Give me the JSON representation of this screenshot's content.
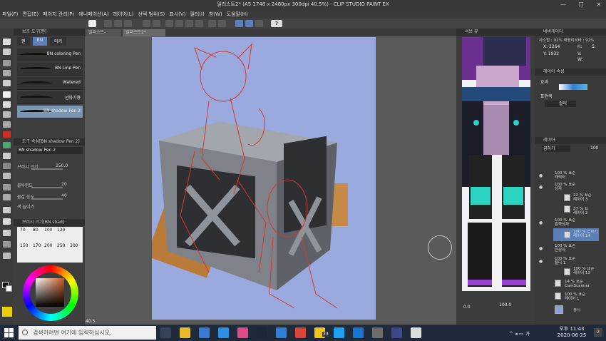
{
  "window": {
    "title": "일러스트2* (A5 1748 x 2480px 300dpi 40.5%) - CLIP STUDIO PAINT EX",
    "minimize": "—",
    "maximize": "☐",
    "close": "✕"
  },
  "menu": [
    "파일(F)",
    "편집(E)",
    "페이지 관리(P)",
    "애니메이션(A)",
    "레이어(L)",
    "선택 범위(S)",
    "표시(V)",
    "필터(I)",
    "창(W)",
    "도움말(H)"
  ],
  "toolbar": {
    "help": "?",
    "icons": [
      "clip-studio-icon",
      "new-icon",
      "open-icon",
      "save-icon",
      "undo-icon",
      "redo-icon",
      "clear-icon",
      "transform-icon",
      "fill-icon",
      "deselect-icon",
      "selection-icon",
      "crop-icon",
      "lasso-icon",
      "show-icon",
      "settings-icon"
    ]
  },
  "subtool": {
    "header": "보조 도구[펜]",
    "tabs": [
      "펜",
      "BN",
      "마커"
    ],
    "brushes": [
      "BN coloring Pen",
      "BN Line Pen",
      "Watered",
      "선따기용",
      "BN shadow Pen 2"
    ],
    "selected": 4
  },
  "tool_property": {
    "header": "도구 속성[BN shadow Pen 2]",
    "name": "BN shadow Pen 2",
    "brush_size_label": "브러시 크기",
    "brush_size": "250.0",
    "opacity_label": "불투명도",
    "opacity": "20",
    "density_label": "물감 농도",
    "density": "40",
    "extra_label": "색 늘이기"
  },
  "brush_size_panel": {
    "header": "브러시 크기[BN shad]",
    "sizes": [
      "70",
      "80",
      "100",
      "120",
      "150",
      "170",
      "200",
      "250",
      "300"
    ]
  },
  "docs": {
    "tab1": "일러스트-",
    "tab2": "일러스트2*"
  },
  "canvas": {
    "zoom": "40.5",
    "zoom2": "0.0"
  },
  "reference": {
    "header": "서브 뷰"
  },
  "navigator": {
    "header": "네비게이터",
    "zoom_text": "사소합 : 92% 래핑리서바 : 92%",
    "x_label": "X: 2264",
    "y_label": "Y: 1932",
    "h_label": "H:",
    "v_label": "V:",
    "w_label": "W:",
    "s_label": "S:"
  },
  "layer_prop": {
    "header": "레이어 속성",
    "effect_label": "효과",
    "color_label": "표현색",
    "color_value": "컬러"
  },
  "layers": {
    "header": "레이어",
    "blend": "곱하기",
    "opacity": "100",
    "items": [
      {
        "text": "100 % 표준\n캐릭터"
      },
      {
        "text": "100 % 표준\n상자"
      },
      {
        "text": "22 % 표준\n레이어 3"
      },
      {
        "text": "37 % 표\n레이어 2"
      },
      {
        "text": "100 % 표준\n왼쪽상자"
      },
      {
        "text": "100 % 곱하기\n레이어 14"
      },
      {
        "text": "100 % 표준\n큰상자"
      },
      {
        "text": "100 % 표준\n폴더 1"
      },
      {
        "text": "100 % 표준\n레이어 13"
      },
      {
        "text": "14 % 표준\nCamScanner"
      },
      {
        "text": "100 % 표준\n레이어 1"
      },
      {
        "text": "용지"
      }
    ]
  },
  "bottom_panel": {
    "value": "100.0"
  },
  "taskbar": {
    "search_placeholder": "검색하려면 여기에 입력하십시오.",
    "badge": "23",
    "time": "오후 11:43",
    "date": "2020-06-25",
    "notif": "2"
  },
  "colors": {
    "canvas_bg": "#9aaade",
    "accent_pen": "#c8302a",
    "selected_brush": "#7a98b4"
  }
}
